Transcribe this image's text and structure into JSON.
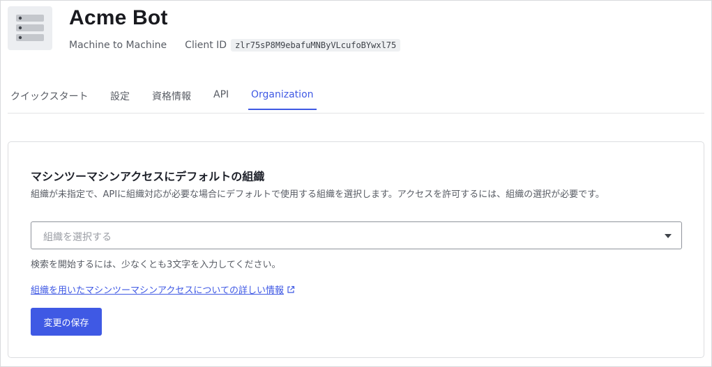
{
  "app": {
    "name": "Acme Bot",
    "type": "Machine to Machine",
    "client_id_label": "Client ID",
    "client_id": "zlr75sP8M9ebafuMNByVLcufoBYwxl75",
    "icon": "server-icon"
  },
  "tabs": [
    {
      "label": "クイックスタート",
      "active": false
    },
    {
      "label": "設定",
      "active": false
    },
    {
      "label": "資格情報",
      "active": false
    },
    {
      "label": "API",
      "active": false
    },
    {
      "label": "Organization",
      "active": true
    }
  ],
  "section": {
    "title": "マシンツーマシンアクセスにデフォルトの組織",
    "description": "組織が未指定で、APIに組織対応が必要な場合にデフォルトで使用する組織を選択します。アクセスを許可するには、組織の選択が必要です。",
    "select_placeholder": "組織を選択する",
    "hint": "検索を開始するには、少なくとも3文字を入力してください。",
    "link_text": "組織を用いたマシンツーマシンアクセスについての詳しい情報",
    "save_label": "変更の保存"
  },
  "colors": {
    "accent": "#3f59e4",
    "text": "#1e212a",
    "muted": "#585c64",
    "border": "#dcdde0"
  }
}
